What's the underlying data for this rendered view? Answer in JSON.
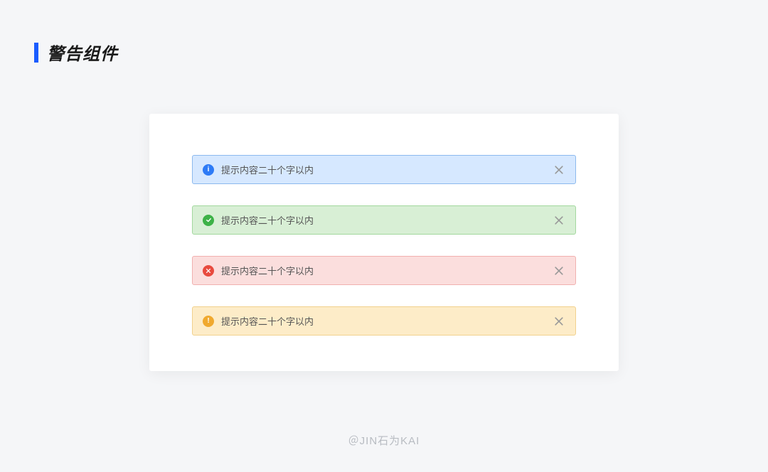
{
  "page": {
    "title": "警告组件"
  },
  "alerts": [
    {
      "type": "info",
      "message": "提示内容二十个字以内"
    },
    {
      "type": "success",
      "message": "提示内容二十个字以内"
    },
    {
      "type": "error",
      "message": "提示内容二十个字以内"
    },
    {
      "type": "warning",
      "message": "提示内容二十个字以内"
    }
  ],
  "watermark": "＠JIN石为KAI",
  "colors": {
    "accent": "#1a5cff",
    "info": {
      "bg": "#d6e8ff",
      "border": "#8cb9ee",
      "icon": "#2e7bf6"
    },
    "success": {
      "bg": "#d8efd5",
      "border": "#a3d89e",
      "icon": "#3db247"
    },
    "error": {
      "bg": "#fbdedd",
      "border": "#f1b0af",
      "icon": "#e84b3f"
    },
    "warning": {
      "bg": "#fdecc8",
      "border": "#f1d18d",
      "icon": "#f0a92f"
    }
  }
}
